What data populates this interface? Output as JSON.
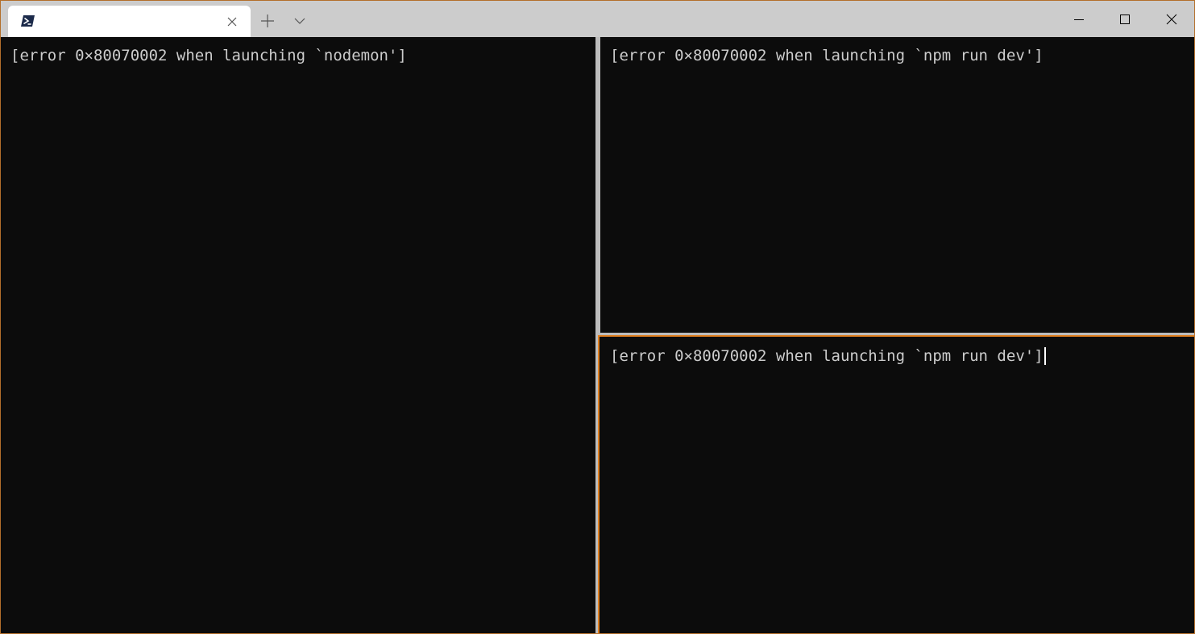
{
  "titlebar": {
    "tab": {
      "icon": "powershell-icon",
      "title": "",
      "close_icon": "close-icon"
    },
    "new_tab_icon": "plus-icon",
    "dropdown_icon": "chevron-down-icon",
    "window_controls": {
      "minimize_icon": "minimize-icon",
      "maximize_icon": "maximize-icon",
      "close_icon": "close-icon"
    }
  },
  "panes": {
    "left": {
      "output": "[error 0×80070002 when launching `nodemon']"
    },
    "top_right": {
      "output": "[error 0×80070002 when launching `npm run dev']"
    },
    "bottom_right": {
      "output": "[error 0×80070002 when launching `npm run dev']",
      "focused": true
    }
  },
  "colors": {
    "terminal_background": "#0c0c0c",
    "terminal_text": "#cccccc",
    "focused_pane_border": "#e07f1f",
    "titlebar_background": "#cccccc",
    "window_border": "#b36f2b"
  }
}
